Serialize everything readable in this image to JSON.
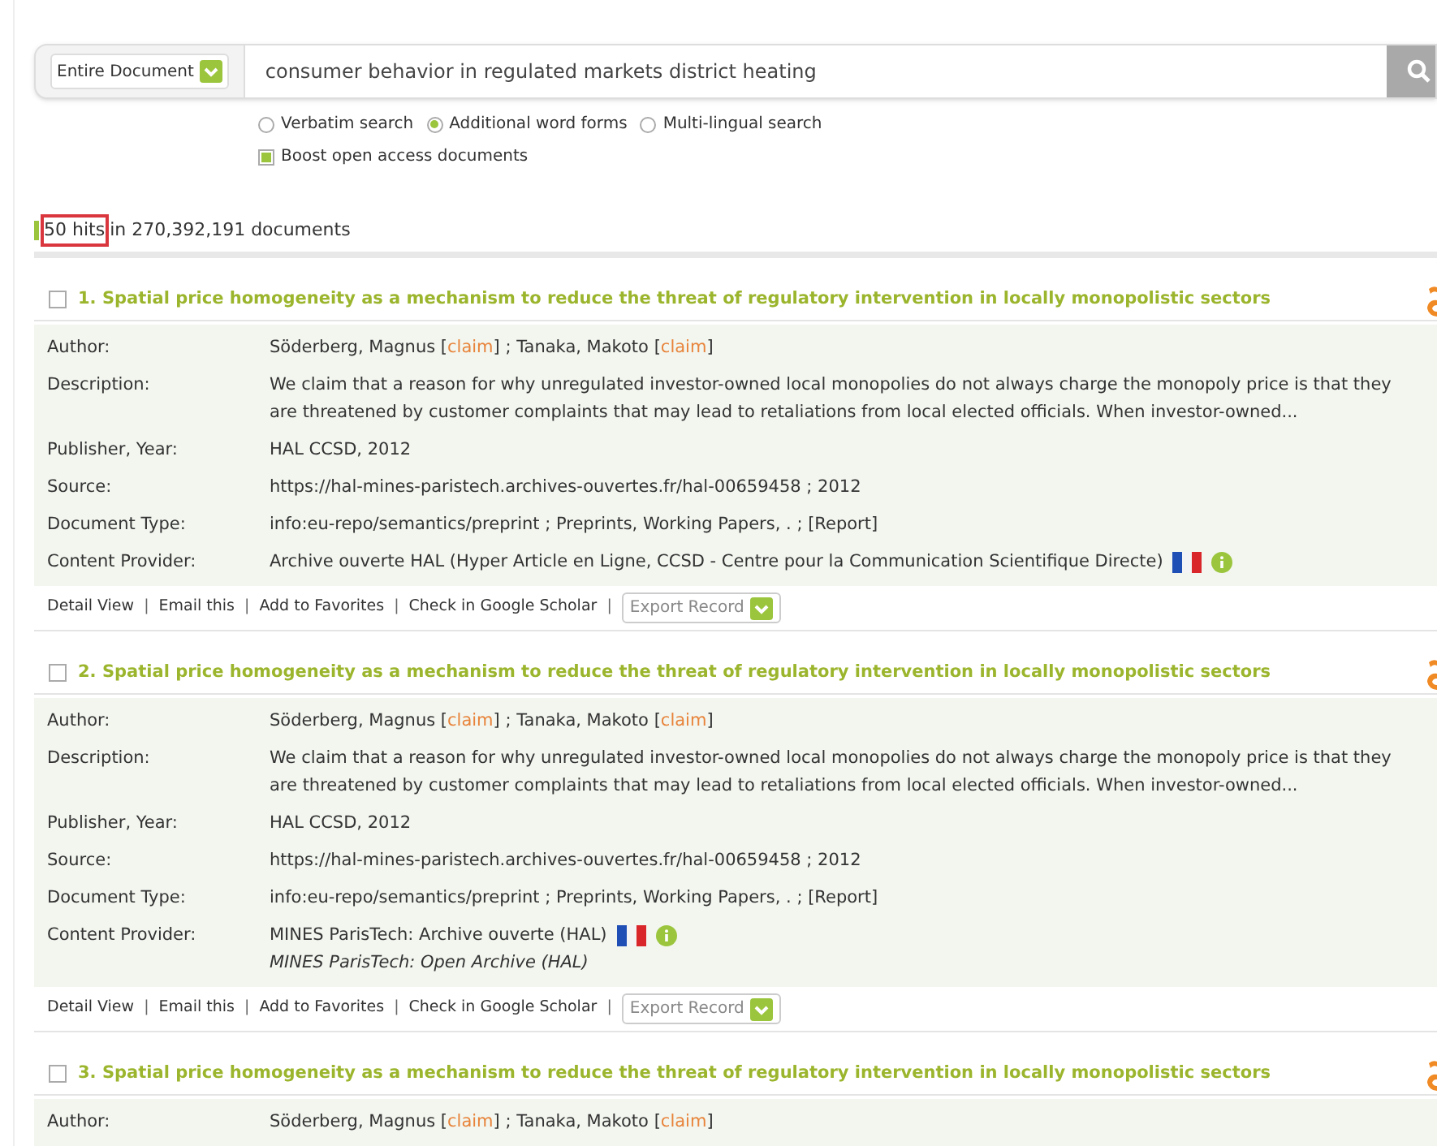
{
  "search": {
    "scope": "Entire Document",
    "query": "consumer behavior in regulated markets district heating"
  },
  "options": [
    {
      "label": "Verbatim search",
      "selected": false
    },
    {
      "label": "Additional word forms",
      "selected": true
    },
    {
      "label": "Multi-lingual search",
      "selected": false
    }
  ],
  "boost": {
    "label": "Boost open access documents",
    "checked": true
  },
  "hits": {
    "count": "50 hits",
    "rest": "in 270,392,191 documents"
  },
  "records": [
    {
      "title": "1. Spatial price homogeneity as a mechanism to reduce the threat of regulatory intervention in locally monopolistic sectors",
      "checked": false,
      "fields": [
        {
          "kind": "authors",
          "label": "Author:",
          "segments": [
            {
              "kind": "text",
              "text": "Söderberg, Magnus ["
            },
            {
              "kind": "link",
              "text": "claim"
            },
            {
              "kind": "text",
              "text": "] ; Tanaka, Makoto ["
            },
            {
              "kind": "link",
              "text": "claim"
            },
            {
              "kind": "text",
              "text": "]"
            }
          ]
        },
        {
          "kind": "text",
          "label": "Description:",
          "value": "We claim that a reason for why unregulated investor-owned local monopolies do not always charge the monopoly price is that they are threatened by customer complaints that may lead to retaliations from local elected officials. When investor-owned..."
        },
        {
          "kind": "text",
          "label": "Publisher, Year:",
          "value": "HAL CCSD, 2012"
        },
        {
          "kind": "text",
          "label": "Source:",
          "value": "https://hal-mines-paristech.archives-ouvertes.fr/hal-00659458 ; 2012"
        },
        {
          "kind": "text",
          "label": "Document Type:",
          "value": "info:eu-repo/semantics/preprint ; Preprints, Working Papers, . ; [Report]"
        },
        {
          "kind": "provider",
          "label": "Content Provider:",
          "value": "Archive ouverte HAL (Hyper Article en Ligne, CCSD - Centre pour la Communication Scientifique Directe)"
        }
      ],
      "actions": [
        "Detail View",
        "Email this",
        "Add to Favorites",
        "Check in Google Scholar"
      ],
      "separator": "|",
      "export": "Export Record"
    },
    {
      "title": "2. Spatial price homogeneity as a mechanism to reduce the threat of regulatory intervention in locally monopolistic sectors",
      "checked": false,
      "fields": [
        {
          "kind": "authors",
          "label": "Author:",
          "segments": [
            {
              "kind": "text",
              "text": "Söderberg, Magnus ["
            },
            {
              "kind": "link",
              "text": "claim"
            },
            {
              "kind": "text",
              "text": "] ; Tanaka, Makoto ["
            },
            {
              "kind": "link",
              "text": "claim"
            },
            {
              "kind": "text",
              "text": "]"
            }
          ]
        },
        {
          "kind": "text",
          "label": "Description:",
          "value": "We claim that a reason for why unregulated investor-owned local monopolies do not always charge the monopoly price is that they are threatened by customer complaints that may lead to retaliations from local elected officials. When investor-owned..."
        },
        {
          "kind": "text",
          "label": "Publisher, Year:",
          "value": "HAL CCSD, 2012"
        },
        {
          "kind": "text",
          "label": "Source:",
          "value": "https://hal-mines-paristech.archives-ouvertes.fr/hal-00659458 ; 2012"
        },
        {
          "kind": "text",
          "label": "Document Type:",
          "value": "info:eu-repo/semantics/preprint ; Preprints, Working Papers, . ; [Report]"
        },
        {
          "kind": "provider",
          "label": "Content Provider:",
          "value": "MINES ParisTech: Archive ouverte (HAL)",
          "translation": "MINES ParisTech: Open Archive (HAL)"
        }
      ],
      "actions": [
        "Detail View",
        "Email this",
        "Add to Favorites",
        "Check in Google Scholar"
      ],
      "separator": "|",
      "export": "Export Record"
    },
    {
      "title": "3. Spatial price homogeneity as a mechanism to reduce the threat of regulatory intervention in locally monopolistic sectors",
      "checked": false,
      "fields": [
        {
          "kind": "authors",
          "label": "Author:",
          "segments": [
            {
              "kind": "text",
              "text": "Söderberg, Magnus ["
            },
            {
              "kind": "link",
              "text": "claim"
            },
            {
              "kind": "text",
              "text": "] ; Tanaka, Makoto ["
            },
            {
              "kind": "link",
              "text": "claim"
            },
            {
              "kind": "text",
              "text": "]"
            }
          ]
        }
      ]
    }
  ]
}
